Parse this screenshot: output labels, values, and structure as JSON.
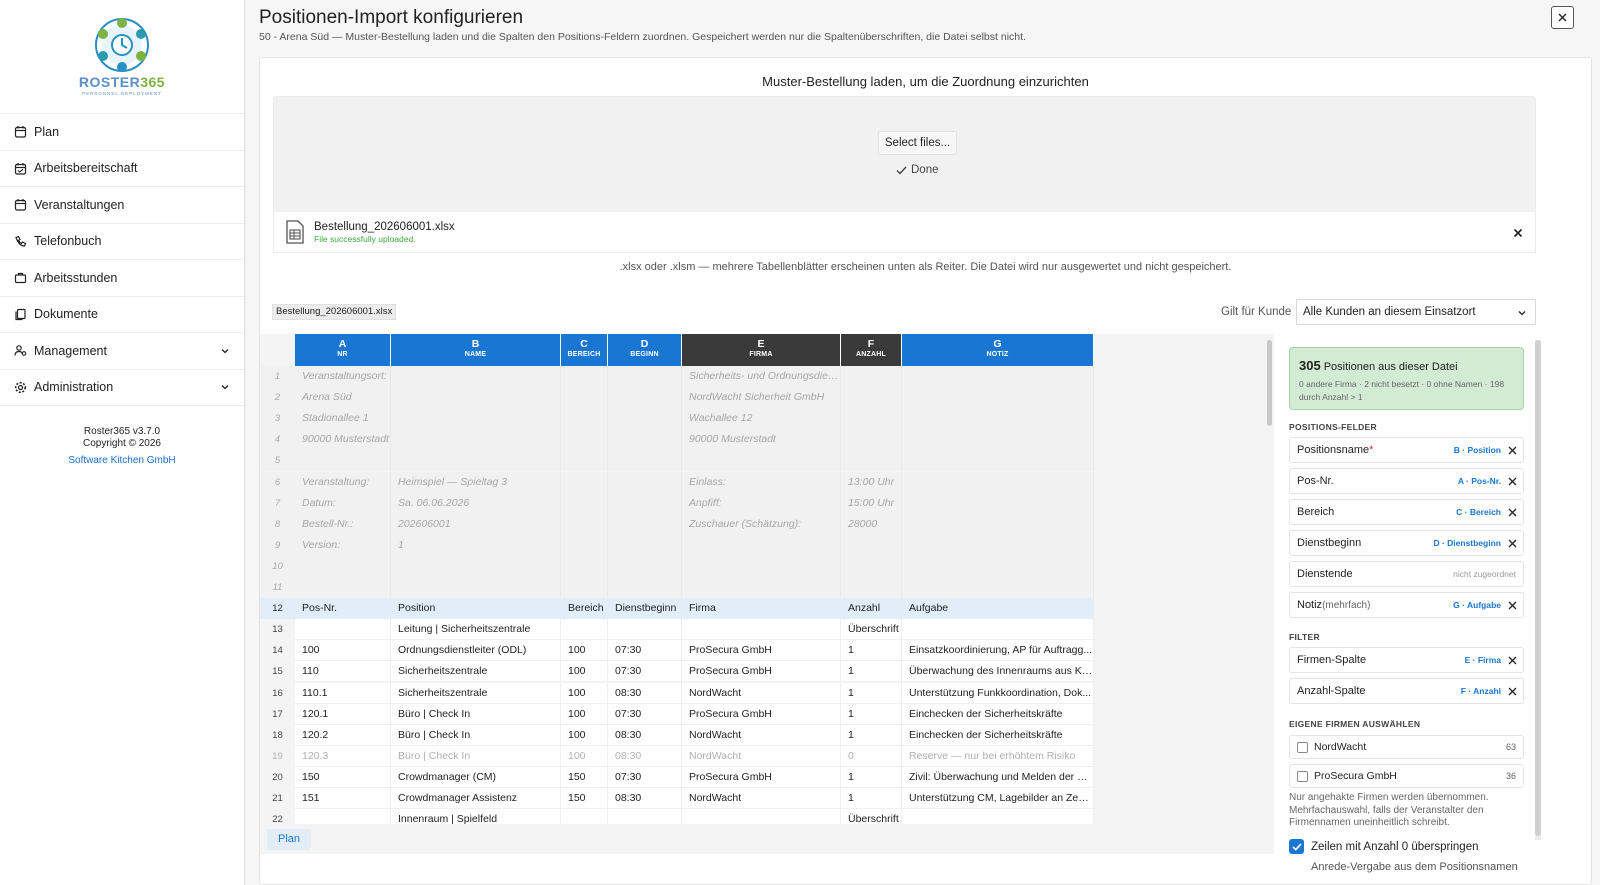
{
  "app": {
    "logo_r": "RO",
    "logo_rest": "STER",
    "logo_num": "365",
    "logo_tagline": "PERSONNEL DEPLOYMENT",
    "version": "Roster365 v3.7.0",
    "copyright": "Copyright © 2026",
    "company_link": "Software Kitchen GmbH"
  },
  "sidebar": {
    "items": [
      {
        "label": "Plan",
        "icon": "calendar-icon"
      },
      {
        "label": "Arbeitsbereitschaft",
        "icon": "calendar-check-icon"
      },
      {
        "label": "Veranstaltungen",
        "icon": "calendar-icon"
      },
      {
        "label": "Telefonbuch",
        "icon": "phone-icon"
      },
      {
        "label": "Arbeitsstunden",
        "icon": "briefcase-icon"
      },
      {
        "label": "Dokumente",
        "icon": "documents-icon"
      },
      {
        "label": "Management",
        "icon": "users-icon",
        "expandable": true
      },
      {
        "label": "Administration",
        "icon": "gear-icon",
        "expandable": true
      }
    ]
  },
  "dialog": {
    "title": "Positionen-Import konfigurieren",
    "subtitle": "50 - Arena Süd — Muster-Bestellung laden und die Spalten den Positions-Feldern zuordnen. Gespeichert werden nur die Spaltenüberschriften, die Datei selbst nicht.",
    "close_icon": "close-icon"
  },
  "upload": {
    "title": "Muster-Bestellung laden, um die Zuordnung einzurichten",
    "select_button": "Select files...",
    "done_label": "Done",
    "file_name": "Bestellung_202606001.xlsx",
    "file_status": "File successfully uploaded.",
    "hint": ".xlsx oder .xlsm — mehrere Tabellenblätter erscheinen unten als Reiter. Die Datei wird nur ausgewertet und nicht gespeichert."
  },
  "toolbar": {
    "sheet_name": "Bestellung_202606001.xlsx",
    "kunde_label": "Gilt für Kunde",
    "kunde_value": "Alle Kunden an diesem Einsatzort"
  },
  "grid": {
    "columns": [
      {
        "letter": "A",
        "sub": "NR"
      },
      {
        "letter": "B",
        "sub": "NAME"
      },
      {
        "letter": "C",
        "sub": "BEREICH"
      },
      {
        "letter": "D",
        "sub": "BEGINN"
      },
      {
        "letter": "E",
        "sub": "FIRMA"
      },
      {
        "letter": "F",
        "sub": "ANZAHL"
      },
      {
        "letter": "G",
        "sub": "NOTIZ"
      }
    ],
    "rows": [
      {
        "n": "1",
        "kind": "meta",
        "c": [
          "Veranstaltungsort:",
          "",
          "",
          "",
          "Sicherheits- und Ordnungsdienst",
          "",
          ""
        ]
      },
      {
        "n": "2",
        "kind": "meta",
        "c": [
          "Arena Süd",
          "",
          "",
          "",
          "NordWacht Sicherheit GmbH",
          "",
          ""
        ]
      },
      {
        "n": "3",
        "kind": "meta",
        "c": [
          "Stadionallee 1",
          "",
          "",
          "",
          "Wachallee 12",
          "",
          ""
        ]
      },
      {
        "n": "4",
        "kind": "meta",
        "c": [
          "90000 Musterstadt",
          "",
          "",
          "",
          "90000 Musterstadt",
          "",
          ""
        ]
      },
      {
        "n": "5",
        "kind": "meta",
        "c": [
          "",
          "",
          "",
          "",
          "",
          "",
          ""
        ]
      },
      {
        "n": "6",
        "kind": "meta",
        "c": [
          "Veranstaltung:",
          "Heimspiel — Spieltag 3",
          "",
          "",
          "Einlass:",
          "13:00 Uhr",
          ""
        ]
      },
      {
        "n": "7",
        "kind": "meta",
        "c": [
          "Datum:",
          "Sa. 06.06.2026",
          "",
          "",
          "Anpfiff:",
          "15:00 Uhr",
          ""
        ]
      },
      {
        "n": "8",
        "kind": "meta",
        "c": [
          "Bestell-Nr.:",
          "202606001",
          "",
          "",
          "Zuschauer (Schätzung):",
          "28000",
          ""
        ]
      },
      {
        "n": "9",
        "kind": "meta",
        "c": [
          "Version:",
          "1",
          "",
          "",
          "",
          "",
          ""
        ]
      },
      {
        "n": "10",
        "kind": "meta",
        "c": [
          "",
          "",
          "",
          "",
          "",
          "",
          ""
        ]
      },
      {
        "n": "11",
        "kind": "meta",
        "c": [
          "",
          "",
          "",
          "",
          "",
          "",
          ""
        ]
      },
      {
        "n": "12",
        "kind": "header",
        "c": [
          "Pos-Nr.",
          "Position",
          "Bereich",
          "Dienstbeginn",
          "Firma",
          "Anzahl",
          "Aufgabe"
        ]
      },
      {
        "n": "13",
        "kind": "data",
        "c": [
          "",
          "Leitung | Sicherheitszentrale",
          "",
          "",
          "",
          "Überschrift",
          ""
        ]
      },
      {
        "n": "14",
        "kind": "data",
        "c": [
          "100",
          "Ordnungsdienstleiter (ODL)",
          "100",
          "07:30",
          "ProSecura GmbH",
          "1",
          "Einsatzkoordinierung, AP für Auftragg..."
        ]
      },
      {
        "n": "15",
        "kind": "data",
        "c": [
          "110",
          "Sicherheitszentrale",
          "100",
          "07:30",
          "ProSecura GmbH",
          "1",
          "Überwachung des Innenraums aus Kan..."
        ]
      },
      {
        "n": "16",
        "kind": "data",
        "c": [
          "110.1",
          "Sicherheitszentrale",
          "100",
          "08:30",
          "NordWacht",
          "1",
          "Unterstützung Funkkoordination, Dok..."
        ]
      },
      {
        "n": "17",
        "kind": "data",
        "c": [
          "120.1",
          "Büro | Check In",
          "100",
          "07:30",
          "ProSecura GmbH",
          "1",
          "Einchecken der Sicherheitskräfte"
        ]
      },
      {
        "n": "18",
        "kind": "data",
        "c": [
          "120.2",
          "Büro | Check In",
          "100",
          "08:30",
          "NordWacht",
          "1",
          "Einchecken der Sicherheitskräfte"
        ]
      },
      {
        "n": "19",
        "kind": "skipped",
        "c": [
          "120.3",
          "Büro | Check In",
          "100",
          "08:30",
          "NordWacht",
          "0",
          "Reserve — nur bei erhöhtem Risiko"
        ]
      },
      {
        "n": "20",
        "kind": "data",
        "c": [
          "150",
          "Crowdmanager (CM)",
          "150",
          "07:30",
          "ProSecura GmbH",
          "1",
          "Zivil: Überwachung und Melden der Be..."
        ]
      },
      {
        "n": "21",
        "kind": "data",
        "c": [
          "151",
          "Crowdmanager Assistenz",
          "150",
          "08:30",
          "NordWacht",
          "1",
          "Unterstützung CM, Lagebilder an Zent..."
        ]
      },
      {
        "n": "22",
        "kind": "data",
        "c": [
          "",
          "Innenraum | Spielfeld",
          "",
          "",
          "",
          "Überschrift",
          ""
        ]
      }
    ],
    "sheet_tab": "Plan"
  },
  "panel": {
    "summary_count": "305",
    "summary_text": "Positionen aus dieser Datei",
    "summary_detail": "0 andere Firma · 2 nicht besetzt · 0 ohne Namen · 198 durch Anzahl > 1",
    "fields_title": "POSITIONS-FELDER",
    "fields": [
      {
        "label": "Positionsname",
        "required": "*",
        "map": "B · Position"
      },
      {
        "label": "Pos-Nr.",
        "map": "A · Pos-Nr."
      },
      {
        "label": "Bereich",
        "map": "C · Bereich"
      },
      {
        "label": "Dienstbeginn",
        "map": "D · Dienstbeginn"
      },
      {
        "label": "Dienstende",
        "unmapped": "nicht zugeordnet"
      },
      {
        "label": "Notiz",
        "suffix": "(mehrfach)",
        "map": "G · Aufgabe"
      }
    ],
    "filter_title": "FILTER",
    "filters": [
      {
        "label": "Firmen-Spalte",
        "map": "E · Firma"
      },
      {
        "label": "Anzahl-Spalte",
        "map": "F · Anzahl"
      }
    ],
    "firms_title": "EIGENE FIRMEN AUSWÄHLEN",
    "firms": [
      {
        "name": "NordWacht",
        "count": "63"
      },
      {
        "name": "ProSecura GmbH",
        "count": "36"
      }
    ],
    "firms_note": "Nur angehakte Firmen werden übernommen. Mehrfachauswahl, falls der Veranstalter den Firmennamen uneinheitlich schreibt.",
    "skip_zero_label": "Zeilen mit Anzahl 0 überspringen",
    "cut_label": "Anrede-Vergabe aus dem Positionsnamen"
  }
}
